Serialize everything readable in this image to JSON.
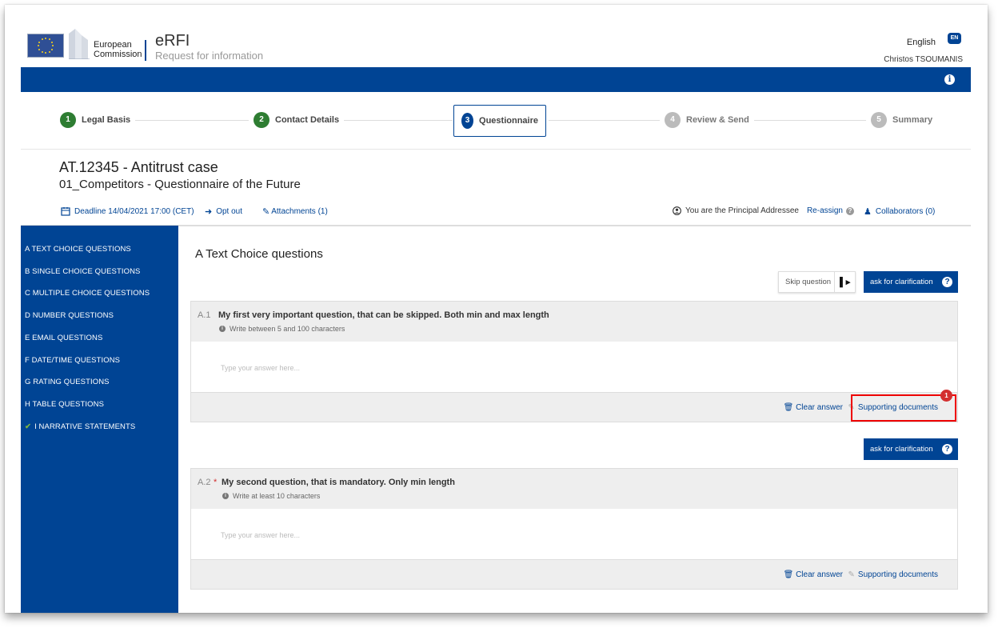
{
  "header": {
    "logo_line1": "European",
    "logo_line2": "Commission",
    "app_title": "eRFI",
    "app_subtitle": "Request for information",
    "language": "English",
    "language_code": "EN",
    "user": "Christos TSOUMANIS",
    "info_icon": "info-icon"
  },
  "steps": [
    {
      "num": "1",
      "label": "Legal Basis",
      "state": "done"
    },
    {
      "num": "2",
      "label": "Contact Details",
      "state": "done"
    },
    {
      "num": "3",
      "label": "Questionnaire",
      "state": "active"
    },
    {
      "num": "4",
      "label": "Review & Send",
      "state": "todo"
    },
    {
      "num": "5",
      "label": "Summary",
      "state": "todo"
    }
  ],
  "case": {
    "title": "AT.12345 - Antitrust case",
    "subtitle": "01_Competitors - Questionnaire of the Future",
    "deadline": "Deadline 14/04/2021 17:00 (CET)",
    "opt_out": "Opt out",
    "attachments": "Attachments (1)",
    "principal": "You are the Principal Addressee",
    "reassign": "Re-assign",
    "collaborators": "Collaborators (0)"
  },
  "sidebar": {
    "items": [
      {
        "label": "A TEXT CHOICE QUESTIONS"
      },
      {
        "label": "B SINGLE CHOICE QUESTIONS"
      },
      {
        "label": "C MULTIPLE CHOICE QUESTIONS"
      },
      {
        "label": "D NUMBER QUESTIONS"
      },
      {
        "label": "E EMAIL QUESTIONS"
      },
      {
        "label": "F DATE/TIME QUESTIONS"
      },
      {
        "label": "G RATING QUESTIONS"
      },
      {
        "label": "H TABLE QUESTIONS"
      },
      {
        "label": "I NARRATIVE STATEMENTS",
        "checked": true
      }
    ]
  },
  "main": {
    "section_title": "A Text Choice questions",
    "skip_label": "Skip question",
    "clarification_label": "ask for clarification",
    "questions": [
      {
        "num": "A.1",
        "mandatory": false,
        "text": "My first very important question, that can be skipped. Both min and max length",
        "hint": "Write between 5 and 100 characters",
        "placeholder": "Type your answer here...",
        "clear_label": "Clear answer",
        "support_label": "Supporting documents",
        "support_count": "1"
      },
      {
        "num": "A.2",
        "mandatory": true,
        "mandatory_mark": "*",
        "text": "My second question, that is mandatory. Only min length",
        "hint": "Write at least 10 characters",
        "placeholder": "Type your answer here...",
        "clear_label": "Clear answer",
        "support_label": "Supporting documents"
      }
    ]
  },
  "colors": {
    "primary": "#004494",
    "done": "#2e7d32",
    "todo": "#bbbbbb",
    "highlight": "#ee0000",
    "badge": "#d32f2f"
  }
}
